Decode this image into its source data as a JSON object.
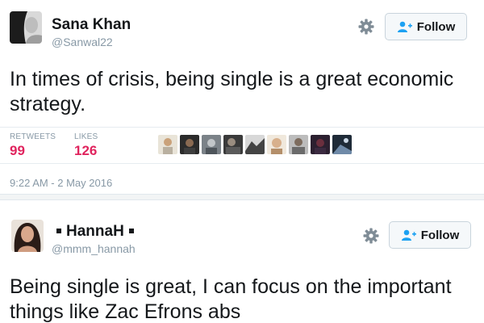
{
  "tweets": [
    {
      "display_name": "Sana Khan",
      "handle": "@Sanwal22",
      "follow_label": "Follow",
      "text": "In times of crisis, being single is a great economic strategy.",
      "retweets_label": "RETWEETS",
      "retweets_count": "99",
      "likes_label": "LIKES",
      "likes_count": "126",
      "timestamp": "9:22 AM - 2 May 2016",
      "liker_avatar_count": 9
    },
    {
      "display_name": "HannaH",
      "handle": "@mmm_hannah",
      "follow_label": "Follow",
      "text": "Being single is great, I can focus on the important things like Zac Efrons abs"
    }
  ],
  "icons": {
    "gear": "gear-icon",
    "follow": "follow-person-plus-icon"
  },
  "colors": {
    "likes_count": "#e0245e",
    "muted_text": "#8899a6",
    "follow_icon": "#1da1f2"
  }
}
